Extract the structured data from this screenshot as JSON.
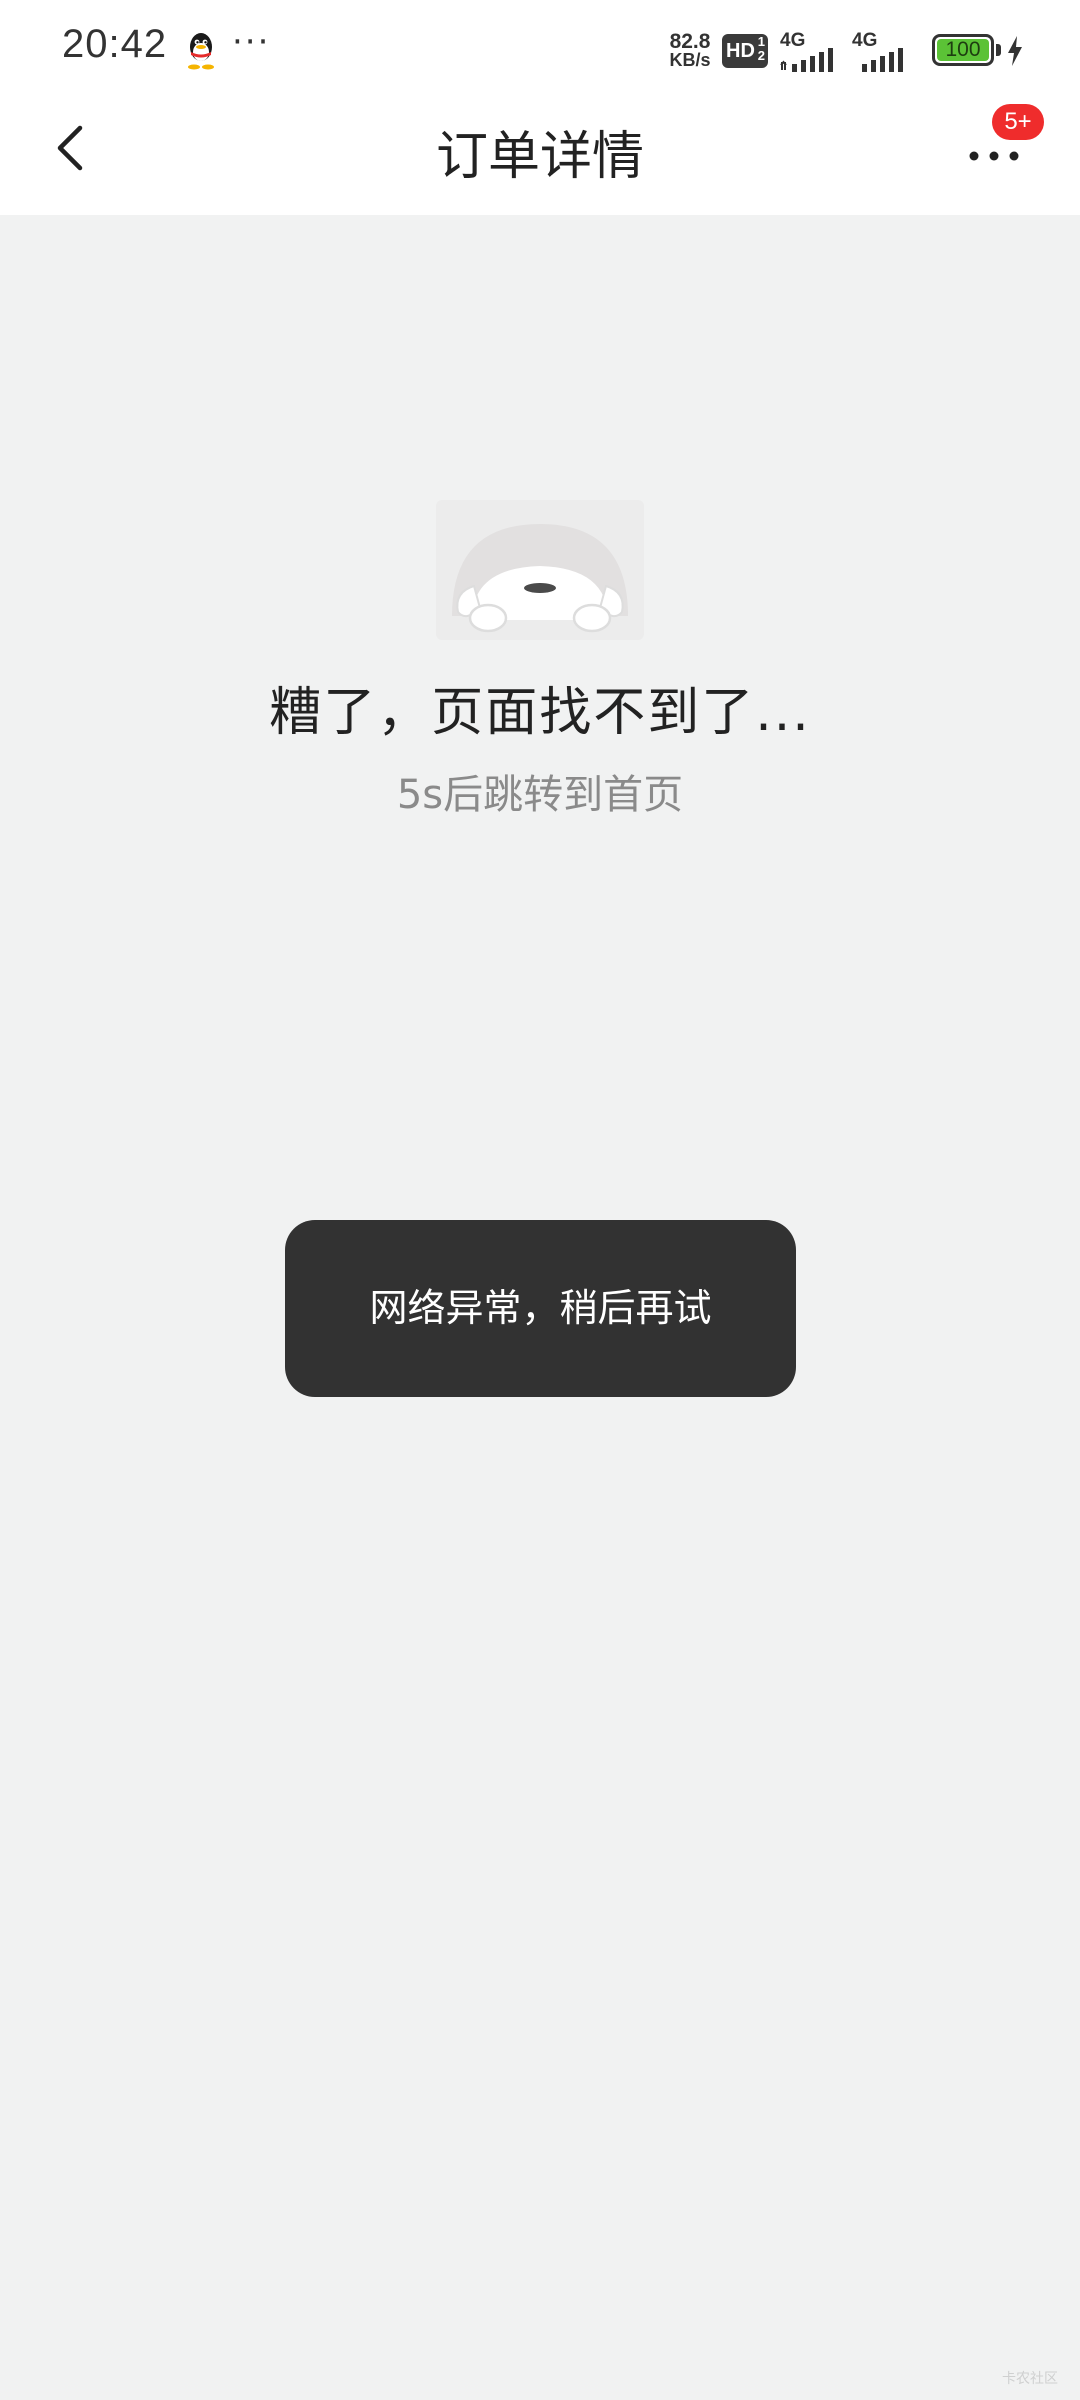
{
  "status_bar": {
    "time": "20:42",
    "more": "···",
    "net_speed_value": "82.8",
    "net_speed_unit": "KB/s",
    "hd_label": "HD",
    "hd_sub_top": "1",
    "hd_sub_bottom": "2",
    "sim1_label": "4G",
    "sim2_label": "4G",
    "battery_level": "100",
    "battery_fill_fraction": 1.0,
    "battery_color": "#5bc236"
  },
  "navbar": {
    "title": "订单详情",
    "badge": "5+",
    "badge_color": "#ef2c2c"
  },
  "error": {
    "title": "糟了，页面找不到了...",
    "redirect": "5s后跳转到首页"
  },
  "toast": {
    "message": "网络异常，稍后再试"
  },
  "watermark": {
    "text": "卡农社区"
  }
}
